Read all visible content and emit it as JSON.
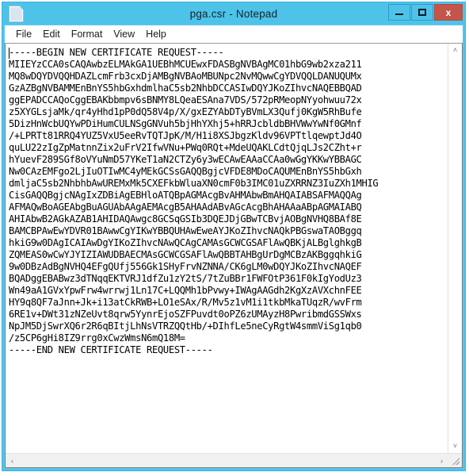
{
  "window": {
    "title": "pga.csr - Notepad",
    "icon": "notepad-document-icon",
    "accent_color": "#4EC3EA",
    "close_color": "#C4554B",
    "caption_buttons": [
      {
        "name": "minimize",
        "label": ""
      },
      {
        "name": "maximize",
        "label": ""
      },
      {
        "name": "close",
        "label": "x"
      }
    ]
  },
  "menubar": {
    "items": [
      {
        "label": "File"
      },
      {
        "label": "Edit"
      },
      {
        "label": "Format"
      },
      {
        "label": "View"
      },
      {
        "label": "Help"
      }
    ]
  },
  "editor": {
    "content": "-----BEGIN NEW CERTIFICATE REQUEST-----\nMIIEYzCCA0sCAQAwbzELMAkGA1UEBhMCUEwxFDASBgNVBAgMC01hbG9wb2xza211\nMQ8wDQYDVQQHDAZLcmFrb3cxDjAMBgNVBAoMBUNpc2NvMQwwCgYDVQQLDANUQUMx\nGzAZBgNVBAMMEnBnYS5hbGxhdmlhaC5sb2NhbDCCASIwDQYJKoZIhvcNAQEBBQAD\nggEPADCCAQoCggEBAKbbmpv6sBNMY8LQeaESAna7VDS/572pRMeopNYyohwuu72x\nz5XYGLsjaMk/qr4yHhd1pP0dQ58V4p/X/gxEZYAbDTyBVmLX3Qufj0KgW5RhBufe\n5DizHnWcbUQYwPDiHumCULNSgGNVuh5bjHhYXhj5+hRRJcbldbBHVWwYwNf0GMnf\n/+LPRTt81RRQ4YUZ5VxU5eeRvTQTJpK/M/H1i8XSJbgzKldv96VPTtlqewptJd4O\nquLU22zIgZpMatnnZix2uFrV2IfwVNu+PWq0RQt+MdeUQAKLCdtQjqLJs2CZht+r\nhYuevF289SGf8oVYuNmD57YKeT1aN2CTZy6y3wECAwEAAaCCAa0wGgYKKwYBBAGC\nNw0CAzEMFgo2LjIuOTIwMC4yMEkGCSsGAQQBgjcVFDE8MDoCAQUMEnBnYS5hbGxh\ndmljaC5sb2NhbhbAwUREMxMk5CXEFkbWluaXN0cmF0b3IMC01uZXRRNZ3IuZXh1MHIG\nCisGAQQBgjcNAgIxZDBiAgEBHloATQBpAGMAcgBvAHMAbwBmAHQAIABSAFMAQQAg\nAFMAQwBoAGEAbgBuAGUAbAAgAEMAcgB5AHAAdABvAGcAcgBhAHAAaABpAGMAIABQ\nAHIAbwB2AGkAZAB1AHIDAQAwgc8GCSqGSIb3DQEJDjGBwTCBvjAOBgNVHQ8BAf8E\nBAMCBPAwEwYDVR01BAwwCgYIKwYBBQUHAwEweAYJKoZIhvcNAQkPBGswaTAOBggq\nhkiG9w0DAgICAIAwDgYIKoZIhvcNAwQCAgCAMAsGCWCGSAFlAwQBKjALBglghkgB\nZQMEAS0wCwYJYIZIAWUDBAECMAsGCWCGSAFlAwQBBTAHBgUrDgMCBzAKBggqhkiG\n9w0DBzAdBgNVHQ4EFgQUfj556Gk1SHyFrvNZNNA/CK6gLM0wDQYJKoZIhvcNAQEF\nBQADggEBABwz3dTNqqEKTVRJ1dfZu1zY2tS/7tZuBBr1FWFOtP361F0kIgYodUz3\nWn49aA1GVxYpwFrw4wrrwj1Ln17C+LQQMh1bPvwy+IWAgAAGdh2KgXzAVXchnFEE\nHY9q8QF7aJnn+Jk+i13atCkRWB+LO1eSAx/R/Mv5z1vM1i1tkbMkaTUqzR/wvFrm\n6RE1v+DWt31zNZeUvt8qrw5YynrEjoSZFPuvdt0oPZ6zUMAyzH8PwribmdGSSWxs\nNpJM5DjSwrXQ6r2R6qBItjLhNsVTRZQQtHb/+DIhfLe5neCyRgtW4smmViSg1qb0\n/z5CP6gHi8IZ9rrg0xCwzWmsN6mQ18M=\n-----END NEW CERTIFICATE REQUEST-----"
  },
  "scrollbars": {
    "vertical": {
      "up_arrow": "˄",
      "down_arrow": "˅"
    },
    "horizontal": {
      "left_arrow": "‹",
      "right_arrow": "›"
    }
  }
}
